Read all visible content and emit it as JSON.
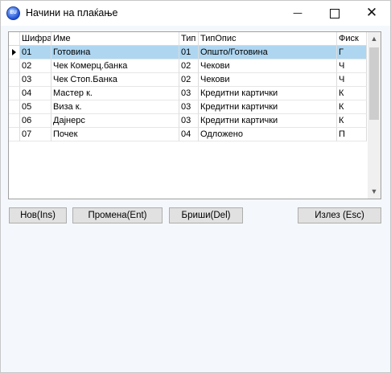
{
  "window": {
    "title": "Начини на плаќање",
    "app_icon_text": "EU",
    "controls": {
      "minimize": "—",
      "close": "✕"
    }
  },
  "grid": {
    "columns": [
      "Шифра",
      "Име",
      "Тип",
      "ТипОпис",
      "Фиск"
    ],
    "selected_row": 0,
    "rows": [
      [
        "01",
        "Готовина",
        "01",
        "Општо/Готовина",
        "Г"
      ],
      [
        "02",
        "Чек Комерц.банка",
        "02",
        "Чекови",
        "Ч"
      ],
      [
        "03",
        "Чек Стоп.Банка",
        "02",
        "Чекови",
        "Ч"
      ],
      [
        "04",
        "Мастер к.",
        "03",
        "Кредитни картички",
        "К"
      ],
      [
        "05",
        "Виза к.",
        "03",
        "Кредитни картички",
        "К"
      ],
      [
        "06",
        "Дајнерс",
        "03",
        "Кредитни картички",
        "К"
      ],
      [
        "07",
        "Почек",
        "04",
        "Одложено",
        "П"
      ]
    ],
    "scroll": {
      "up": "▲",
      "down": "▼"
    }
  },
  "buttons": {
    "new": "Нов(Ins)",
    "edit": "Промена(Ent)",
    "delete": "Бриши(Del)",
    "exit": "Излез (Esc)"
  }
}
